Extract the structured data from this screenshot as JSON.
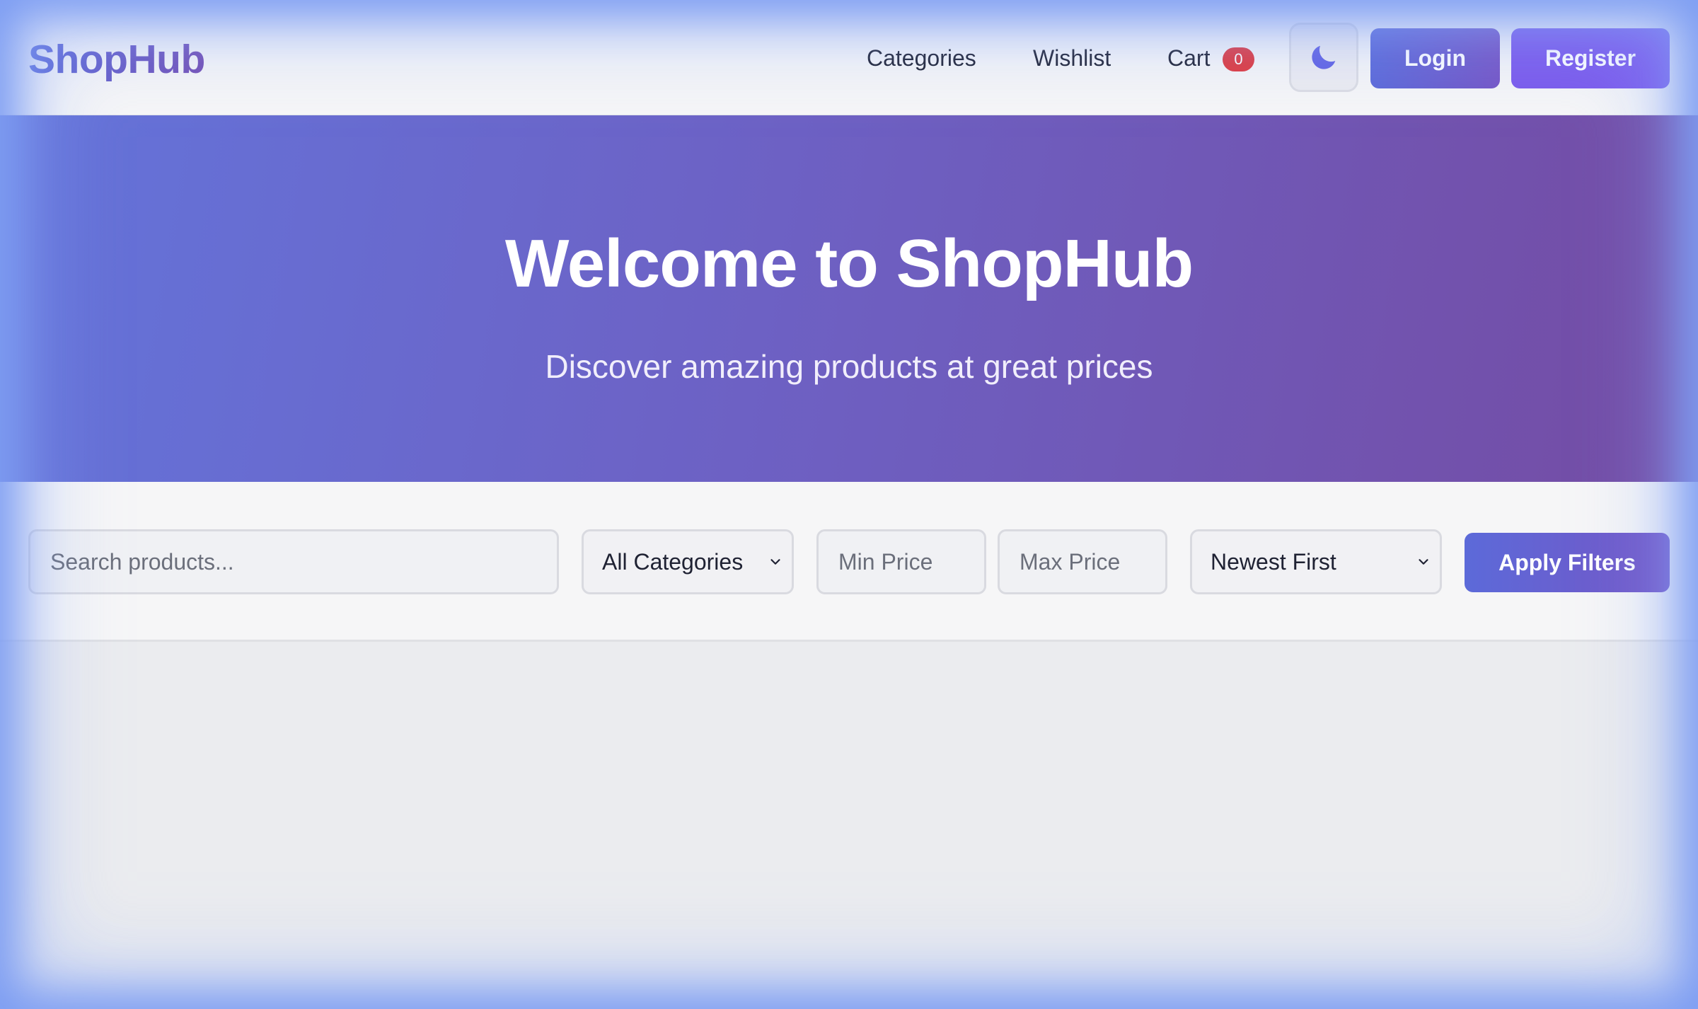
{
  "header": {
    "logo": "ShopHub",
    "nav": {
      "categories": "Categories",
      "wishlist": "Wishlist",
      "cart": "Cart",
      "cart_count": "0"
    },
    "theme_toggle_icon": "moon-icon",
    "login_label": "Login",
    "register_label": "Register"
  },
  "hero": {
    "title": "Welcome to ShopHub",
    "subtitle": "Discover amazing products at great prices"
  },
  "filters": {
    "search_placeholder": "Search products...",
    "category_selected": "All Categories",
    "min_price_placeholder": "Min Price",
    "max_price_placeholder": "Max Price",
    "sort_selected": "Newest First",
    "apply_label": "Apply Filters"
  },
  "colors": {
    "brand_start": "#5b6ad8",
    "brand_end": "#7450b5",
    "register": "#7b5bec",
    "badge": "#e0393d",
    "moon": "#6263e3"
  }
}
